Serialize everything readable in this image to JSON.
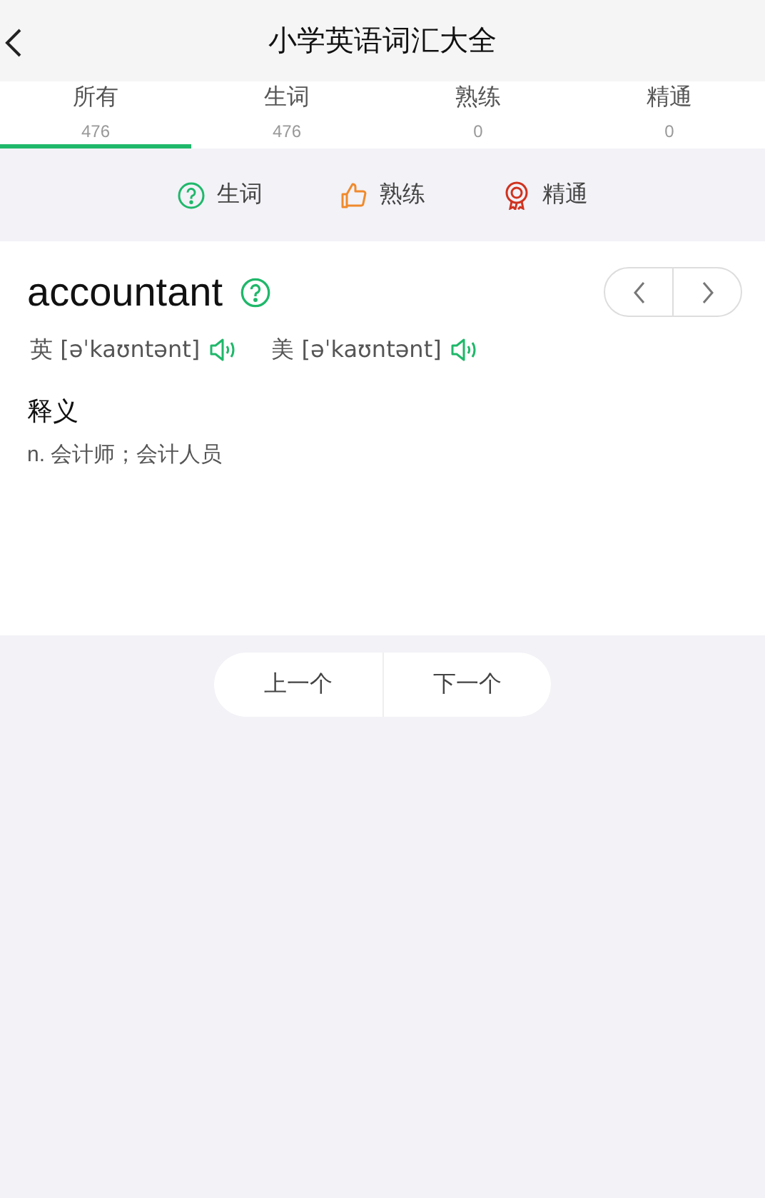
{
  "header": {
    "title": "小学英语词汇大全"
  },
  "tabs": [
    {
      "label": "所有",
      "count": "476",
      "selected": true
    },
    {
      "label": "生词",
      "count": "476",
      "selected": false
    },
    {
      "label": "熟练",
      "count": "0",
      "selected": false
    },
    {
      "label": "精通",
      "count": "0",
      "selected": false
    }
  ],
  "legend": [
    {
      "kind": "new",
      "label": "生词"
    },
    {
      "kind": "familiar",
      "label": "熟练"
    },
    {
      "kind": "mastered",
      "label": "精通"
    }
  ],
  "word": {
    "text": "accountant",
    "kind": "new",
    "pronunciations": [
      {
        "label": "英",
        "phonetic": "[əˈkaʊntənt]"
      },
      {
        "label": "美",
        "phonetic": "[əˈkaʊntənt]"
      }
    ],
    "definition_title": "释义",
    "definition": "n. 会计师；会计人员"
  },
  "nav_buttons": [
    "上一个",
    "下一个"
  ]
}
